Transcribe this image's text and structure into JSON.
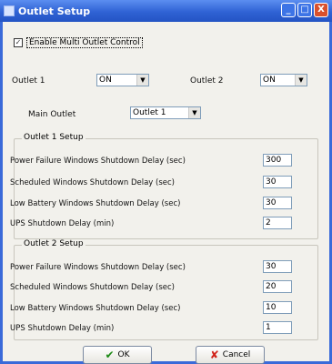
{
  "window": {
    "title": "Outlet Setup",
    "controls": {
      "minimize": "_",
      "maximize": "□",
      "close": "X"
    }
  },
  "multi_outlet": {
    "label": "Enable Multi Outlet Control",
    "checked": true
  },
  "outlets": {
    "outlet1_label": "Outlet 1",
    "outlet1_value": "ON",
    "outlet2_label": "Outlet 2",
    "outlet2_value": "ON",
    "main_label": "Main Outlet",
    "main_value": "Outlet 1"
  },
  "outlet1_setup": {
    "title": "Outlet 1 Setup",
    "rows": [
      {
        "label": "Power Failure Windows Shutdown Delay (sec)",
        "value": "300"
      },
      {
        "label": "Scheduled Windows Shutdown Delay (sec)",
        "value": "30"
      },
      {
        "label": "Low Battery Windows Shutdown Delay (sec)",
        "value": "30"
      },
      {
        "label": "UPS Shutdown Delay (min)",
        "value": "2"
      }
    ]
  },
  "outlet2_setup": {
    "title": "Outlet 2 Setup",
    "rows": [
      {
        "label": "Power Failure Windows Shutdown Delay (sec)",
        "value": "30"
      },
      {
        "label": "Scheduled Windows Shutdown Delay (sec)",
        "value": "20"
      },
      {
        "label": "Low Battery Windows Shutdown Delay (sec)",
        "value": "10"
      },
      {
        "label": "UPS Shutdown Delay (min)",
        "value": "1"
      }
    ]
  },
  "buttons": {
    "ok": "OK",
    "cancel": "Cancel"
  },
  "icons": {
    "ok": "checkmark-icon",
    "cancel": "x-cross-icon",
    "dropdown": "chevron-down-icon"
  },
  "colors": {
    "titlebar": "#2f62d4",
    "ok_icon": "#1d8a16",
    "cancel_icon": "#d1241b",
    "close_button": "#d9502d"
  }
}
